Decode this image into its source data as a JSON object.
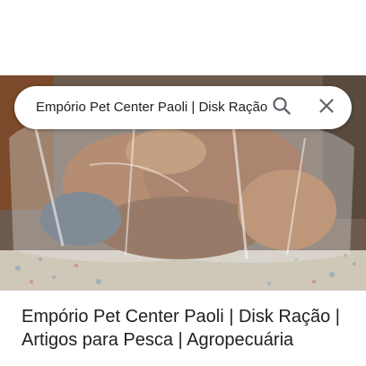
{
  "search": {
    "query": "Empório Pet Center Paoli | Disk Ração | Artigos para Pesca | Agropecuária"
  },
  "result": {
    "title": "Empório Pet Center Paoli | Disk Ração | Artigos para Pesca | Agropecuária"
  },
  "icons": {
    "search": "search-icon",
    "close": "close-icon"
  },
  "colors": {
    "text": "#202124",
    "icon": "#5f6368",
    "background": "#ffffff"
  }
}
